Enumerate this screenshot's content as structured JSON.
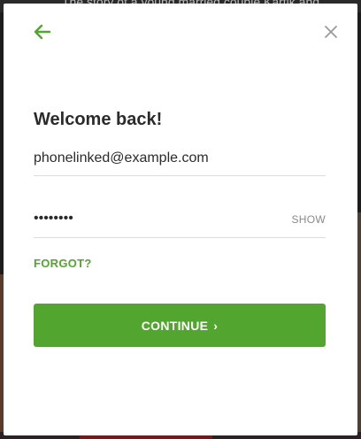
{
  "background": {
    "caption": "The story of a young married couple Kartik and"
  },
  "dialog": {
    "back_icon": "arrow-left-icon",
    "close_icon": "close-icon",
    "title": "Welcome back!",
    "email": {
      "value": "phonelinked@example.com"
    },
    "password": {
      "masked_value": "••••••••",
      "show_label": "SHOW"
    },
    "forgot_label": "FORGOT?",
    "continue_label": "CONTINUE",
    "continue_chevron": "›"
  },
  "colors": {
    "accent": "#52a52e",
    "text": "#2b2b2b",
    "muted": "#8a8a8a",
    "divider": "#dcdcdc"
  }
}
